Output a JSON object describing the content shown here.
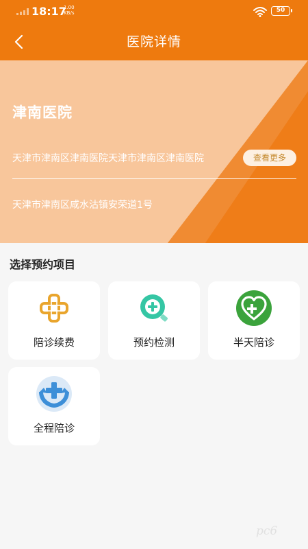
{
  "status_bar": {
    "time": "18:17",
    "net_speed_value": "1.00",
    "net_speed_unit": "KB/s",
    "battery": "50",
    "wifi_icon": "wifi-icon",
    "signal_icon": "signal-icon"
  },
  "nav": {
    "title": "医院详情",
    "back_icon": "chevron-left-icon"
  },
  "hospital": {
    "name": "津南医院",
    "intro": "天津市津南区津南医院天津市津南区津南医院",
    "more_button": "查看更多",
    "address": "天津市津南区咸水沽镇安荣道1号"
  },
  "section": {
    "title": "选择预约项目",
    "items": [
      {
        "label": "陪诊续费",
        "icon": "knot-cross-icon"
      },
      {
        "label": "预约检测",
        "icon": "search-plus-icon"
      },
      {
        "label": "半天陪诊",
        "icon": "heart-cross-icon"
      },
      {
        "label": "全程陪诊",
        "icon": "hands-cross-icon"
      }
    ]
  },
  "watermark": "pc6",
  "colors": {
    "primary": "#ee7a0e",
    "hero_light": "#f8c69b",
    "more_text": "#c58a2f",
    "gold": "#e9a52d",
    "teal": "#35c6a4",
    "green": "#3ba33c",
    "blue": "#3d8fd8"
  }
}
